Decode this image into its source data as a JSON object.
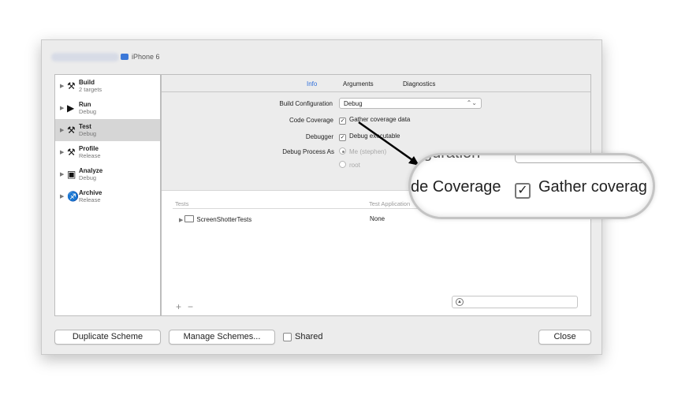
{
  "titlebar": {
    "device": "iPhone 6"
  },
  "sidebar": {
    "items": [
      {
        "name": "Build",
        "sub": "2 targets",
        "icon": "hammer-icon",
        "glyph": "⚒"
      },
      {
        "name": "Run",
        "sub": "Debug",
        "icon": "play-icon",
        "glyph": "▶"
      },
      {
        "name": "Test",
        "sub": "Debug",
        "icon": "wrench-icon",
        "glyph": "⚒",
        "selected": true
      },
      {
        "name": "Profile",
        "sub": "Release",
        "icon": "profile-icon",
        "glyph": "⚒"
      },
      {
        "name": "Analyze",
        "sub": "Debug",
        "icon": "analyze-icon",
        "glyph": "▣"
      },
      {
        "name": "Archive",
        "sub": "Release",
        "icon": "archive-icon",
        "glyph": "♐"
      }
    ]
  },
  "tabs": [
    "Info",
    "Arguments",
    "Diagnostics"
  ],
  "info": {
    "build_configuration_label": "Build Configuration",
    "build_configuration_value": "Debug",
    "code_coverage_label": "Code Coverage",
    "code_coverage_value": "Gather coverage data",
    "debugger_label": "Debugger",
    "debugger_value": "Debug executable",
    "debug_process_label": "Debug Process As",
    "debug_process_option_me": "Me (stephen)",
    "debug_process_option_root": "root"
  },
  "tests": {
    "col_tests": "Tests",
    "col_app": "Test Application",
    "rows": [
      {
        "name": "ScreenShotterTests",
        "app": "None"
      }
    ],
    "add": "+",
    "remove": "−"
  },
  "buttons": {
    "duplicate": "Duplicate Scheme",
    "manage": "Manage Schemes...",
    "shared": "Shared",
    "close": "Close"
  },
  "magnifier": {
    "label": "de Coverage",
    "checkbox": "Gather coverag"
  }
}
